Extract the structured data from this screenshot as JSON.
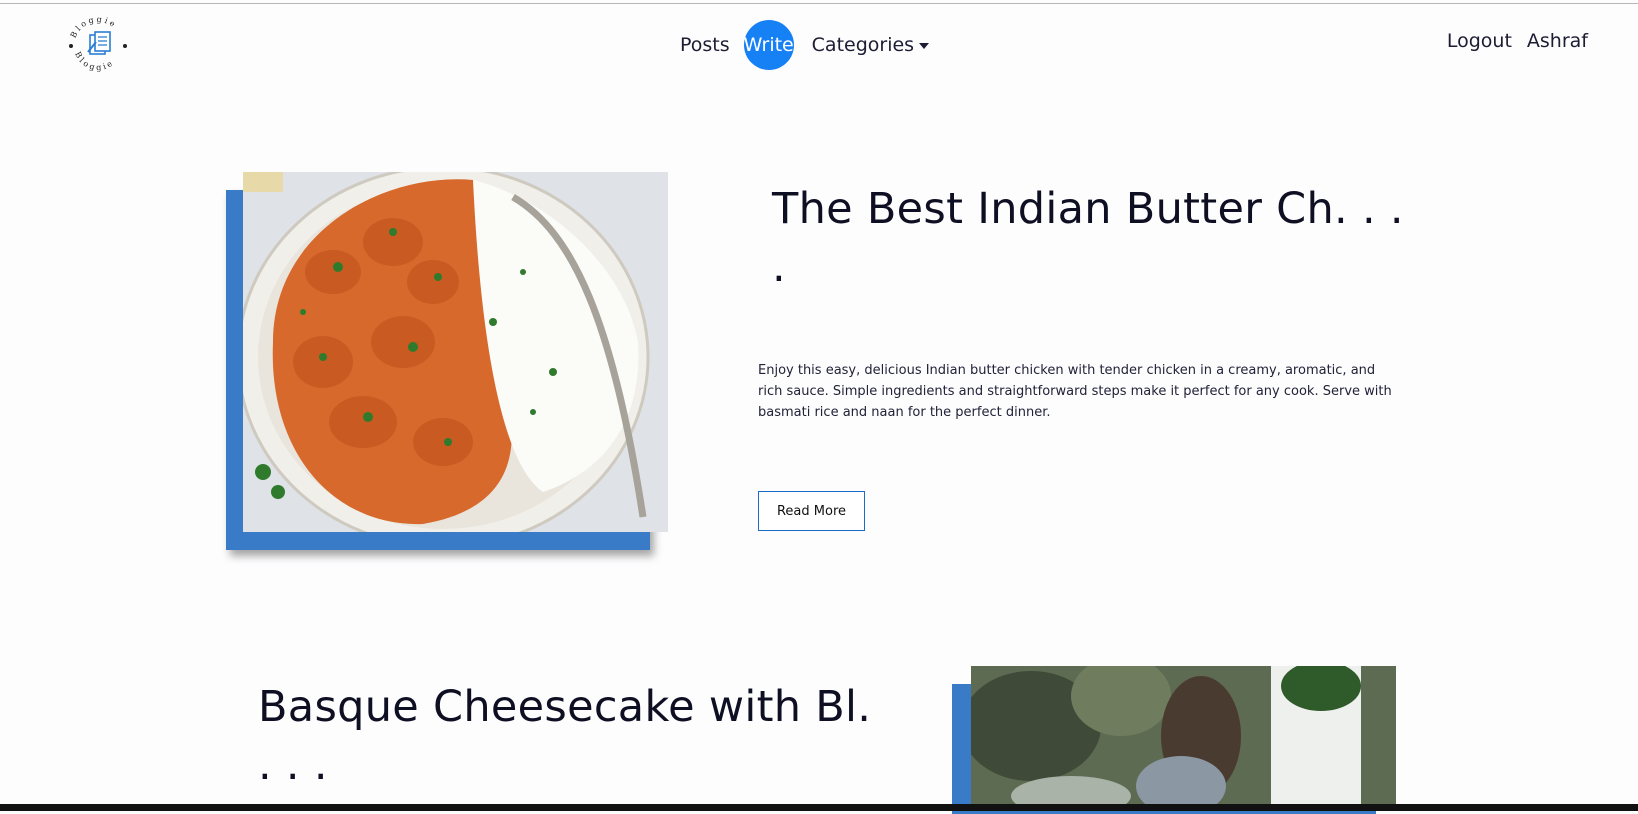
{
  "brand": {
    "logo_text": "Bloggie"
  },
  "nav": {
    "posts": "Posts",
    "write": "Write",
    "categories": "Categories",
    "logout": "Logout",
    "user": "Ashraf"
  },
  "posts": [
    {
      "title": "The Best Indian Butter Ch. . .",
      "title_trail": ".",
      "excerpt": "Enjoy this easy, delicious Indian butter chicken with tender chicken in a creamy, aromatic, and rich sauce. Simple ingredients and straightforward steps make it perfect for any cook. Serve with basmati rice and naan for the perfect dinner.",
      "read_more": "Read More",
      "image_icon": "butter-chicken-photo"
    },
    {
      "title": "Basque Cheesecake with Bl.",
      "title_trail": ". . .",
      "image_icon": "cheesecake-photo"
    }
  ],
  "colors": {
    "accent": "#1680f5",
    "frame": "#3a7bc8",
    "text": "#0f0f23"
  }
}
